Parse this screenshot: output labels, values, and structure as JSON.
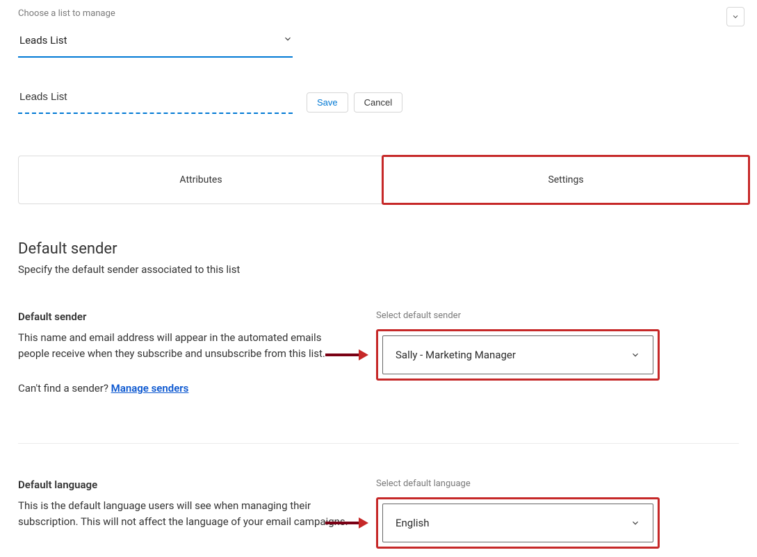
{
  "top": {
    "choose_label": "Choose a list to manage",
    "selected_list": "Leads List"
  },
  "name_input_value": "Leads List",
  "buttons": {
    "save": "Save",
    "cancel": "Cancel"
  },
  "tabs": {
    "attributes": "Attributes",
    "settings": "Settings"
  },
  "default_sender_section": {
    "title": "Default sender",
    "subtitle": "Specify the default sender associated to this list",
    "field_title": "Default sender",
    "field_desc": "This name and email address will appear in the automated emails people receive when they subscribe and unsubscribe from this list.",
    "help_prefix": "Can't find a sender? ",
    "help_link": "Manage senders",
    "select_label": "Select default sender",
    "select_value": "Sally - Marketing Manager"
  },
  "default_language_section": {
    "field_title": "Default language",
    "field_desc": "This is the default language users will see when managing their subscription. This will not affect the language of your email campaigns.",
    "select_label": "Select default language",
    "select_value": "English"
  },
  "annotation_color": "#c62828",
  "link_color": "#0b57d0",
  "primary_color": "#0078d4"
}
